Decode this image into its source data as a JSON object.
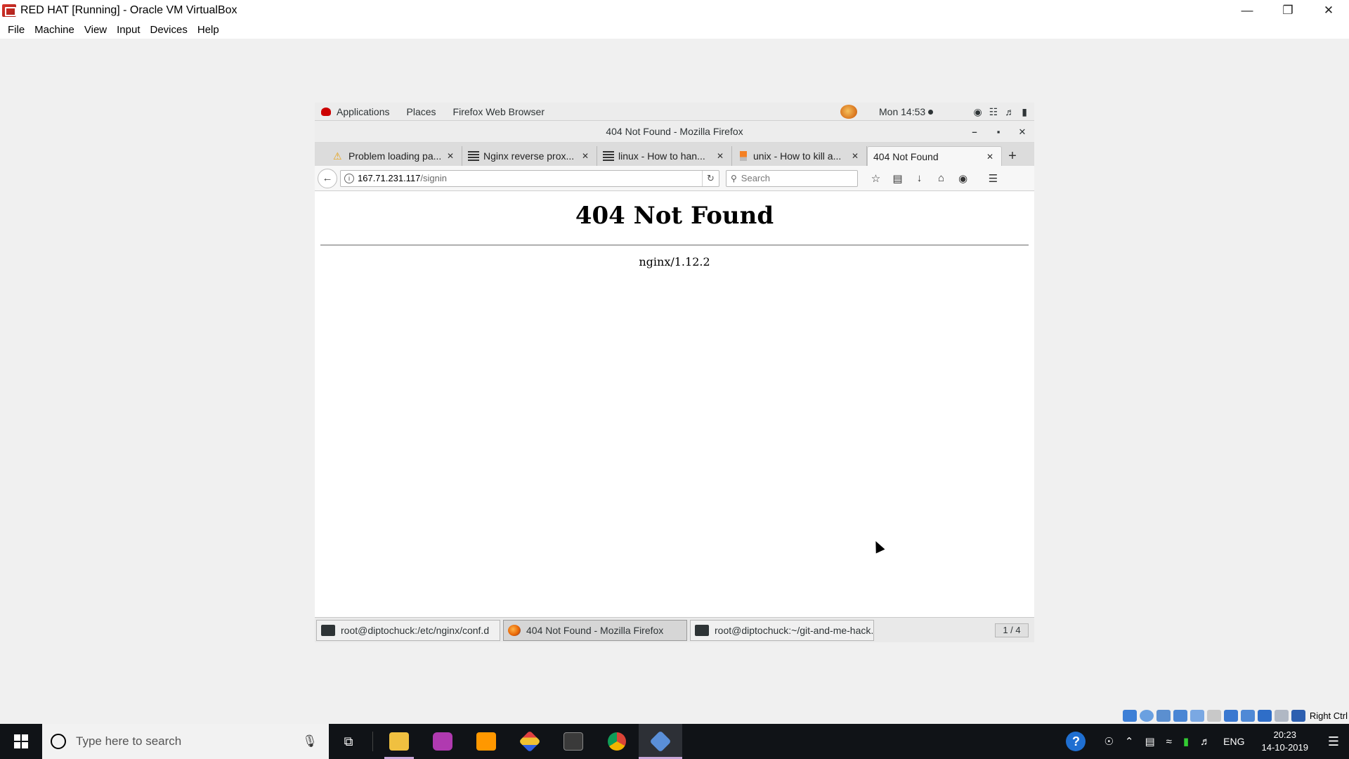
{
  "host": {
    "title": "RED HAT [Running] - Oracle VM VirtualBox",
    "menu": [
      "File",
      "Machine",
      "View",
      "Input",
      "Devices",
      "Help"
    ],
    "host_key": "Right Ctrl"
  },
  "gnome": {
    "applications": "Applications",
    "places": "Places",
    "active_app": "Firefox Web Browser",
    "clock": "Mon 14:53"
  },
  "firefox": {
    "window_title": "404 Not Found - Mozilla Firefox",
    "tabs": [
      {
        "label": "Problem loading pa...",
        "icon": "warning-icon"
      },
      {
        "label": "Nginx reverse prox...",
        "icon": "stack-icon"
      },
      {
        "label": "linux - How to han...",
        "icon": "stack-icon"
      },
      {
        "label": "unix - How to kill a...",
        "icon": "stack-icon"
      },
      {
        "label": "404 Not Found",
        "icon": ""
      }
    ],
    "url_host": "167.71.231.117",
    "url_path": "/signin",
    "search_placeholder": "Search"
  },
  "page": {
    "heading": "404 Not Found",
    "server": "nginx/1.12.2"
  },
  "window_list": {
    "items": [
      {
        "label": "root@diptochuck:/etc/nginx/conf.d",
        "icon": "terminal-icon"
      },
      {
        "label": "404 Not Found - Mozilla Firefox",
        "icon": "firefox-icon"
      },
      {
        "label": "root@diptochuck:~/git-and-me-hack...",
        "icon": "terminal-icon"
      }
    ],
    "pager": "1 / 4"
  },
  "taskbar": {
    "search_placeholder": "Type here to search",
    "language": "ENG",
    "time": "20:23",
    "date": "14-10-2019"
  },
  "colors": {
    "taskbar_bg": "#101317",
    "virtualbox_red": "#d9342b",
    "redhat_red": "#cc0000"
  }
}
